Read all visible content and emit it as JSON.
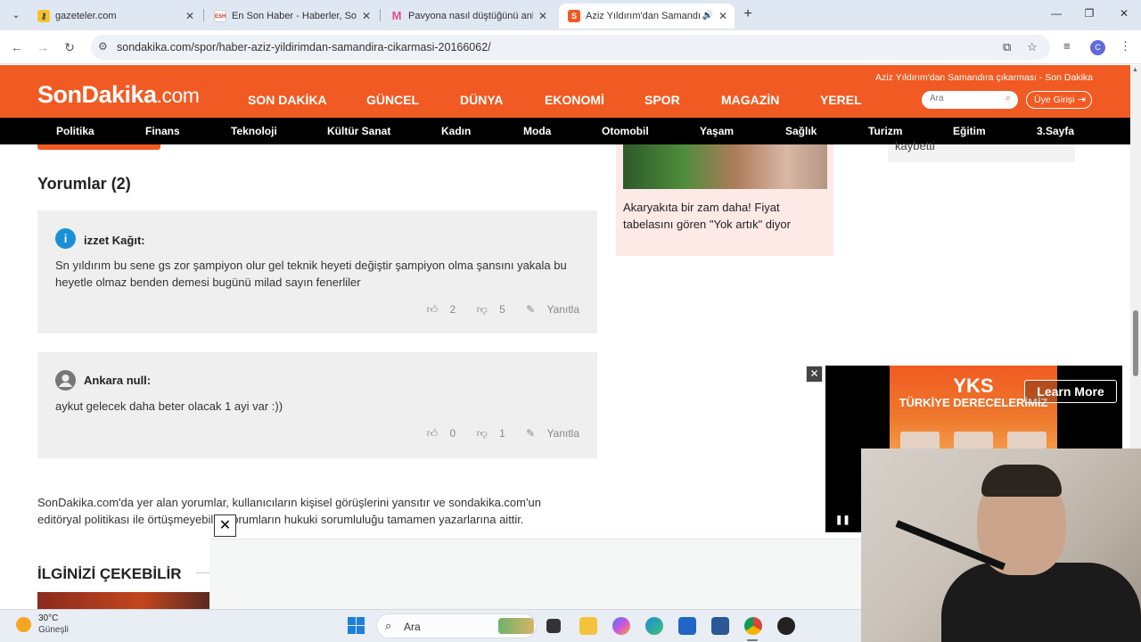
{
  "browser": {
    "tabs": [
      {
        "title": "gazeteler.com",
        "active": false,
        "favicon": "key"
      },
      {
        "title": "En Son Haber - Haberler, Son D",
        "active": false,
        "favicon": "ESH"
      },
      {
        "title": "Pavyona nasıl düştüğünü anlata",
        "active": false,
        "favicon": "M"
      },
      {
        "title": "Aziz Yıldırım'dan Samandıra",
        "active": true,
        "favicon": "S"
      }
    ],
    "url": "sondakika.com/spor/haber-aziz-yildirimdan-samandira-cikarmasi-20166062/"
  },
  "site": {
    "logo_main": "SonDakika",
    "logo_suffix": ".com",
    "strapline": "Aziz Yıldırım'dan Samandıra çıkarması - Son Dakika",
    "search_placeholder": "Ara",
    "login_label": "Üye Girişi",
    "main_nav": [
      "SON DAKİKA",
      "GÜNCEL",
      "DÜNYA",
      "EKONOMİ",
      "SPOR",
      "MAGAZİN",
      "YEREL"
    ],
    "sub_nav": [
      "Politika",
      "Finans",
      "Teknoloji",
      "Kültür Sanat",
      "Kadın",
      "Moda",
      "Otomobil",
      "Yaşam",
      "Sağlık",
      "Turizm",
      "Eğitim",
      "3.Sayfa"
    ]
  },
  "comments": {
    "title": "Yorumlar (2)",
    "items": [
      {
        "author": "izzet Kağıt:",
        "avatar_color": "#1a8fd6",
        "body": "Sn yıldırım bu sene gs zor şampiyon olur gel teknik heyeti değiştir şampiyon olma şansını yakala bu heyetle olmaz benden demesi bugünü milad sayın fenerliler",
        "likes": "2",
        "dislikes": "5",
        "reply": "Yanıtla"
      },
      {
        "author": "Ankara null:",
        "avatar_color": "#777777",
        "body": "aykut gelecek daha beter olacak 1 ayi var :))",
        "likes": "0",
        "dislikes": "1",
        "reply": "Yanıtla"
      }
    ]
  },
  "disclaimer": "SonDakika.com'da yer alan yorumlar, kullanıcıların kişisel görüşlerini yansıtır ve sondakika.com'un editöryal politikası ile örtüşmeyebilir. Yorumların hukuki sorumluluğu tamamen yazarlarına aittir.",
  "related": {
    "title": "İLGİNİZİ ÇEKEBİLİR"
  },
  "sidebar": {
    "news_card": "Akaryakıta bir zam daha! Fiyat tabelasını gören \"Yok artık\" diyor",
    "side_box_text": "kaybetti"
  },
  "video_ad": {
    "headline": "YKS",
    "subline": "TÜRKİYE DERECELERİMİZ",
    "cta": "Learn More"
  },
  "taskbar": {
    "temperature": "30°C",
    "weather": "Güneşli",
    "search_label": "Ara"
  },
  "colors": {
    "brand": "#f15a22",
    "subnav_bg": "#000000"
  }
}
